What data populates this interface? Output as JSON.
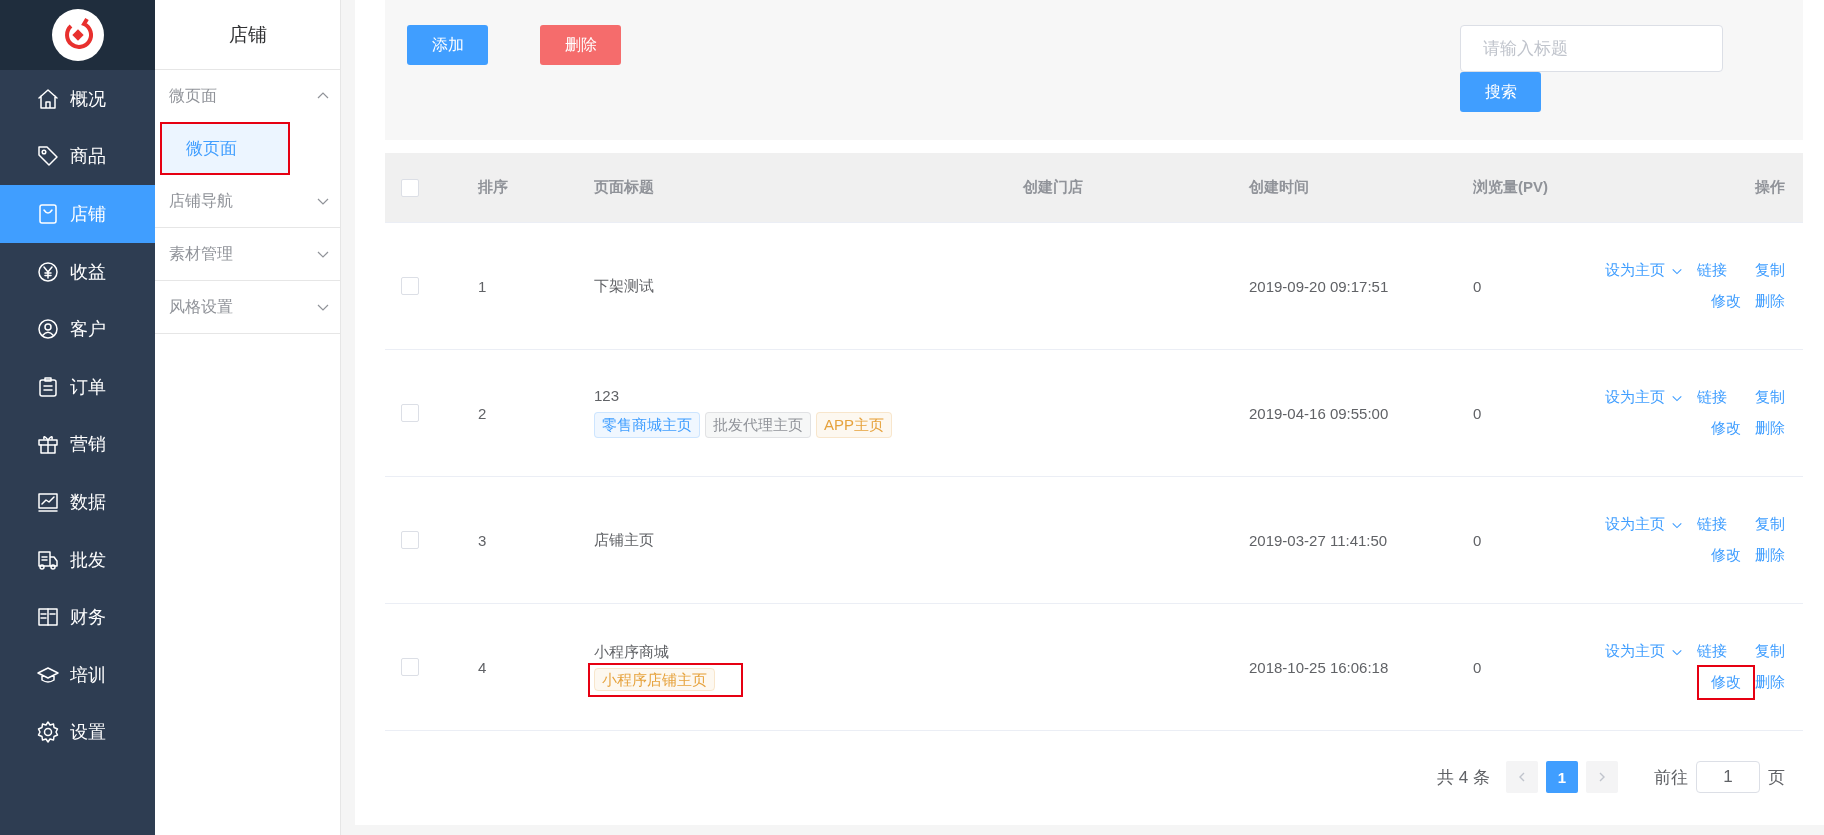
{
  "sidebar": {
    "items": [
      {
        "label": "概况",
        "selected": false
      },
      {
        "label": "商品",
        "selected": false
      },
      {
        "label": "店铺",
        "selected": true
      },
      {
        "label": "收益",
        "selected": false
      },
      {
        "label": "客户",
        "selected": false
      },
      {
        "label": "订单",
        "selected": false
      },
      {
        "label": "营销",
        "selected": false
      },
      {
        "label": "数据",
        "selected": false
      },
      {
        "label": "批发",
        "selected": false
      },
      {
        "label": "财务",
        "selected": false
      },
      {
        "label": "培训",
        "selected": false
      },
      {
        "label": "设置",
        "selected": false
      }
    ]
  },
  "submenu": {
    "title": "店铺",
    "groups": [
      {
        "label": "微页面",
        "expanded": true,
        "children": [
          {
            "label": "微页面",
            "selected": true,
            "highlighted": true
          }
        ]
      },
      {
        "label": "店铺导航",
        "expanded": false
      },
      {
        "label": "素材管理",
        "expanded": false
      },
      {
        "label": "风格设置",
        "expanded": false
      }
    ]
  },
  "toolbar": {
    "buttons": [
      {
        "label": "添加",
        "kind": "primary"
      },
      {
        "label": "删除",
        "kind": "danger"
      }
    ],
    "search": {
      "placeholder": "请输入标题",
      "button": "搜索"
    }
  },
  "table": {
    "header_checked": false,
    "columns": [
      "排序",
      "页面标题",
      "创建门店",
      "创建时间",
      "浏览量(PV)",
      "操作"
    ],
    "rows": [
      {
        "checked": false,
        "order": "1",
        "title": "下架测试",
        "created": "2019-09-20 09:17:51",
        "pv": "0",
        "actions": {
          "set_home": "设为主页",
          "link": "链接",
          "copy": "复制",
          "edit": "修改",
          "delete": "删除",
          "edit_highlighted": false
        }
      },
      {
        "checked": false,
        "order": "2",
        "title": "123",
        "tags": [
          {
            "label": "零售商城主页",
            "color": "#409eff",
            "highlighted": false
          },
          {
            "label": "批发代理主页",
            "color": "#909399",
            "highlighted": false
          },
          {
            "label": "APP主页",
            "color": "#e6a23c",
            "highlighted": false
          }
        ],
        "created": "2019-04-16 09:55:00",
        "pv": "0",
        "actions": {
          "set_home": "设为主页",
          "link": "链接",
          "copy": "复制",
          "edit": "修改",
          "delete": "删除",
          "edit_highlighted": false
        }
      },
      {
        "checked": false,
        "order": "3",
        "title": "店铺主页",
        "created": "2019-03-27 11:41:50",
        "pv": "0",
        "actions": {
          "set_home": "设为主页",
          "link": "链接",
          "copy": "复制",
          "edit": "修改",
          "delete": "删除",
          "edit_highlighted": false
        }
      },
      {
        "checked": false,
        "order": "4",
        "title": "小程序商城",
        "tags": [
          {
            "label": "小程序店铺主页",
            "color": "#e6a23c",
            "highlighted": true
          }
        ],
        "created": "2018-10-25 16:06:18",
        "pv": "0",
        "actions": {
          "set_home": "设为主页",
          "link": "链接",
          "copy": "复制",
          "edit": "修改",
          "delete": "删除",
          "edit_highlighted": true
        }
      }
    ]
  },
  "pagination": {
    "total": "共 4 条",
    "pages": [
      {
        "label": "1",
        "selected": true
      }
    ],
    "goto_label": "前往",
    "goto_value": "1",
    "page_suffix": "页"
  }
}
